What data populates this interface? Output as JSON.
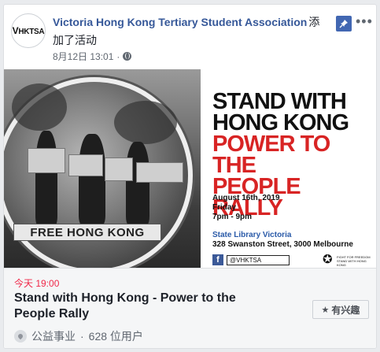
{
  "post": {
    "author": "Victoria Hong Kong Tertiary Student Association",
    "action_part1": "添",
    "action_part2": "加了活动",
    "timestamp": "8月12日 13:01",
    "visibility_icon": "globe-icon",
    "avatar_text_v": "V",
    "avatar_text_rest": "HKTSA"
  },
  "header_actions": {
    "pin_icon": "pin-icon",
    "more_label": "•••"
  },
  "poster": {
    "line1": "STAND WITH",
    "line2": "HONG KONG",
    "line3": "POWER TO THE",
    "line4": "PEOPLE RALLY",
    "date": "August 16th, 2019",
    "day": "Friday",
    "time": "7pm - 9pm",
    "venue_name": "State Library Victoria",
    "venue_address": "328 Swanston Street, 3000 Melbourne",
    "social_icon": "f",
    "handle": "@VHKTSA",
    "banner_text": "FREE HONG KONG",
    "logo_text": "FIGHT FOR FREEDOM STAND WITH HONG KONG"
  },
  "event": {
    "time": "今天 19:00",
    "title": "Stand with Hong Kong - Power to the People Rally",
    "interest_label": "有兴趣",
    "interest_icon": "★",
    "category": "公益事业",
    "separator": " · ",
    "attendance": "628 位用户"
  },
  "colors": {
    "link_blue": "#365899",
    "poster_red": "#d82424",
    "event_time_red": "#f02849"
  }
}
